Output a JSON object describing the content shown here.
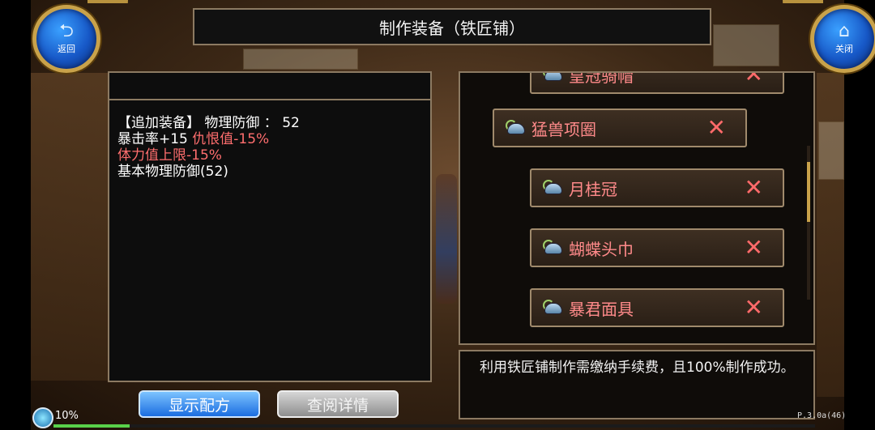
{
  "title": "制作装备（铁匠铺）",
  "buttons": {
    "back_label": "返回",
    "close_label": "关闭",
    "show_recipe": "显示配方",
    "view_details": "查阅详情"
  },
  "icons": {
    "back": "back-arrow-icon",
    "close": "home-icon",
    "item": "helmet-icon",
    "remove": "cross-icon"
  },
  "stats": {
    "line1_prefix": "【追加装备】 物理防御 ：  52",
    "line2_white": "暴击率+15 ",
    "line2_red": "仇恨值-15%",
    "line3_red": "体力值上限-15%",
    "line4": "基本物理防御(52)"
  },
  "items": [
    {
      "name": "皇冠骑帽",
      "mark": "✕"
    },
    {
      "name": "猛兽项圈",
      "mark": "✕"
    },
    {
      "name": "月桂冠",
      "mark": "✕"
    },
    {
      "name": "蝴蝶头巾",
      "mark": "✕"
    },
    {
      "name": "暴君面具",
      "mark": "✕"
    }
  ],
  "info_text": "利用铁匠铺制作需缴纳手续费，且100%制作成功。",
  "status": {
    "percent": "10%",
    "progress": 0.1,
    "version": "P.3.0a(46)"
  },
  "colors": {
    "accent_gold": "#c9a24a",
    "item_text": "#ff8a8a",
    "stat_red": "#ff6e6e"
  }
}
